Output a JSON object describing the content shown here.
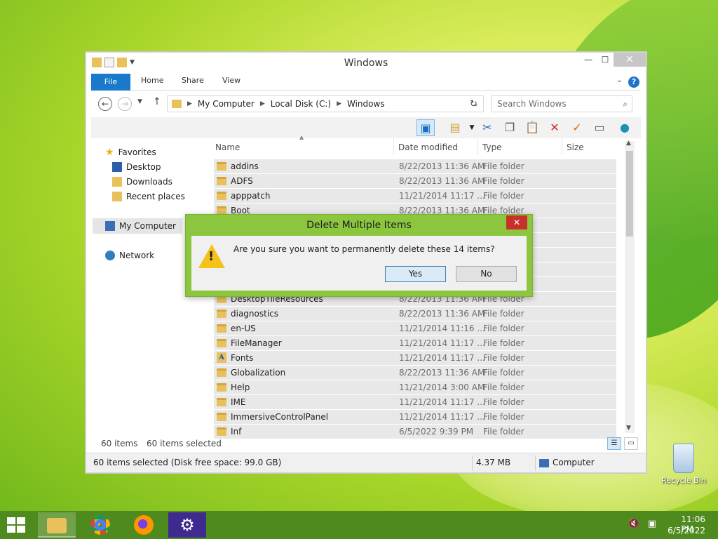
{
  "window": {
    "title": "Windows",
    "ribbon_tabs": [
      "File",
      "Home",
      "Share",
      "View"
    ],
    "help": "?",
    "address": {
      "crumbs": [
        "My Computer",
        "Local Disk (C:)",
        "Windows"
      ]
    },
    "search_placeholder": "Search Windows"
  },
  "nav": {
    "favorites": "Favorites",
    "items": [
      "Desktop",
      "Downloads",
      "Recent places"
    ],
    "computer": "My Computer",
    "network": "Network"
  },
  "columns": {
    "name": "Name",
    "date": "Date modified",
    "type": "Type",
    "size": "Size"
  },
  "files": [
    {
      "name": "addins",
      "date": "8/22/2013 11:36 AM",
      "type": "File folder"
    },
    {
      "name": "ADFS",
      "date": "8/22/2013 11:36 AM",
      "type": "File folder"
    },
    {
      "name": "apppatch",
      "date": "11/21/2014 11:17 ...",
      "type": "File folder"
    },
    {
      "name": "Boot",
      "date": "8/22/2013 11:36 AM",
      "type": "File folder"
    },
    {
      "name": "",
      "date": "",
      "type": ""
    },
    {
      "name": "",
      "date": "",
      "type": ""
    },
    {
      "name": "",
      "date": "",
      "type": ""
    },
    {
      "name": "",
      "date": "",
      "type": ""
    },
    {
      "name": "",
      "date": "",
      "type": ""
    },
    {
      "name": "DesktopTileResources",
      "date": "8/22/2013 11:36 AM",
      "type": "File folder"
    },
    {
      "name": "diagnostics",
      "date": "8/22/2013 11:36 AM",
      "type": "File folder"
    },
    {
      "name": "en-US",
      "date": "11/21/2014 11:16 ...",
      "type": "File folder"
    },
    {
      "name": "FileManager",
      "date": "11/21/2014 11:17 ...",
      "type": "File folder"
    },
    {
      "name": "Fonts",
      "date": "11/21/2014 11:17 ...",
      "type": "File folder"
    },
    {
      "name": "Globalization",
      "date": "8/22/2013 11:36 AM",
      "type": "File folder"
    },
    {
      "name": "Help",
      "date": "11/21/2014 3:00 AM",
      "type": "File folder"
    },
    {
      "name": "IME",
      "date": "11/21/2014 11:17 ...",
      "type": "File folder"
    },
    {
      "name": "ImmersiveControlPanel",
      "date": "11/21/2014 11:17 ...",
      "type": "File folder"
    },
    {
      "name": "Inf",
      "date": "6/5/2022 9:39 PM",
      "type": "File folder"
    }
  ],
  "status": {
    "count": "60 items",
    "selected": "60 items selected"
  },
  "details": {
    "selection": "60 items selected (Disk free space: 99.0 GB)",
    "size": "4.37 MB",
    "location": "Computer"
  },
  "dialog": {
    "title": "Delete Multiple Items",
    "message": "Are you sure you want to permanently delete these 14 items?",
    "yes": "Yes",
    "no": "No"
  },
  "desktop": {
    "recycle_bin": "Recycle Bin"
  },
  "taskbar": {
    "time": "11:06 PM",
    "date": "6/5/2022"
  },
  "colors": {
    "accent": "#1979ca",
    "dialog_frame": "#8cc63f",
    "taskbar": "#4f8a1e",
    "close_red": "#c9302c"
  }
}
